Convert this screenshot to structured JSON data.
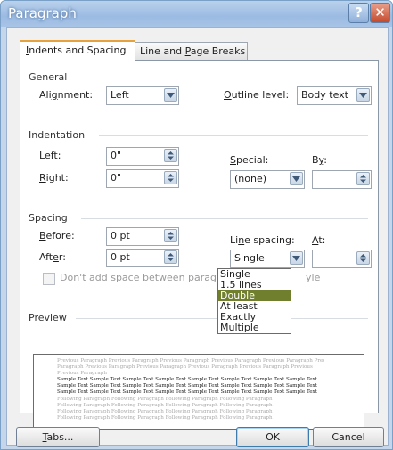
{
  "window": {
    "title": "Paragraph",
    "help_label": "?",
    "close_label": "✕"
  },
  "tabs": [
    {
      "pre": "",
      "key": "I",
      "post": "ndents and Spacing",
      "active": true
    },
    {
      "pre": "Line and ",
      "key": "P",
      "post": "age Breaks",
      "active": false
    }
  ],
  "general": {
    "heading": "General",
    "alignment": {
      "pre": "Ali",
      "key": "g",
      "post": "nment:",
      "value": "Left"
    },
    "outline_level": {
      "pre": "",
      "key": "O",
      "post": "utline level:",
      "value": "Body text"
    }
  },
  "indentation": {
    "heading": "Indentation",
    "left": {
      "pre": "",
      "key": "L",
      "post": "eft:",
      "value": "0\""
    },
    "right": {
      "pre": "",
      "key": "R",
      "post": "ight:",
      "value": "0\""
    },
    "special": {
      "pre": "",
      "key": "S",
      "post": "pecial:",
      "value": "(none)"
    },
    "by": {
      "pre": "B",
      "key": "y",
      "post": ":",
      "value": ""
    }
  },
  "spacing": {
    "heading": "Spacing",
    "before": {
      "pre": "",
      "key": "B",
      "post": "efore:",
      "value": "0 pt"
    },
    "after": {
      "pre": "Aft",
      "key": "e",
      "post": "r:",
      "value": "0 pt"
    },
    "line_spacing": {
      "pre": "Li",
      "key": "n",
      "post": "e spacing:",
      "value": "Single"
    },
    "at": {
      "pre": "",
      "key": "A",
      "post": "t:",
      "value": ""
    },
    "dont_add_space": {
      "visible_left": "Don't add space between paragraph",
      "visible_right": "yle",
      "checked": false
    },
    "line_spacing_options": [
      "Single",
      "1.5 lines",
      "Double",
      "At least",
      "Exactly",
      "Multiple"
    ],
    "line_spacing_highlighted": "Double"
  },
  "preview": {
    "heading": "Preview",
    "lines": [
      {
        "text": "Previous Paragraph Previous Paragraph Previous Paragraph Previous Paragraph Previous Paragraph Previous",
        "tone": "grey"
      },
      {
        "text": "Paragraph Previous Paragraph Previous Paragraph Previous Paragraph Previous Paragraph Previous",
        "tone": "grey"
      },
      {
        "text": "Previous Paragraph",
        "tone": "grey"
      },
      {
        "text": "Sample Text Sample Text Sample Text Sample Text Sample Text Sample Text Sample Text Sample Text",
        "tone": "dark"
      },
      {
        "text": "Sample Text Sample Text Sample Text Sample Text Sample Text Sample Text Sample Text Sample Text",
        "tone": "dark"
      },
      {
        "text": "Sample Text Sample Text Sample Text Sample Text Sample Text Sample Text Sample Text Sample Text",
        "tone": "dark"
      },
      {
        "text": "Following Paragraph Following Paragraph Following Paragraph Following Paragraph",
        "tone": "grey"
      },
      {
        "text": "Following Paragraph Following Paragraph Following Paragraph Following Paragraph",
        "tone": "grey"
      },
      {
        "text": "Following Paragraph Following Paragraph Following Paragraph Following Paragraph",
        "tone": "grey"
      },
      {
        "text": "Following Paragraph Following Paragraph Following Paragraph Following Paragraph",
        "tone": "grey"
      }
    ]
  },
  "buttons": {
    "tabs": {
      "pre": "",
      "key": "T",
      "post": "abs..."
    },
    "ok": "OK",
    "cancel": "Cancel"
  },
  "colors": {
    "accent": "#e6a23c",
    "highlight": "#6f7f2d",
    "title_bar": "#a7c3e6"
  }
}
